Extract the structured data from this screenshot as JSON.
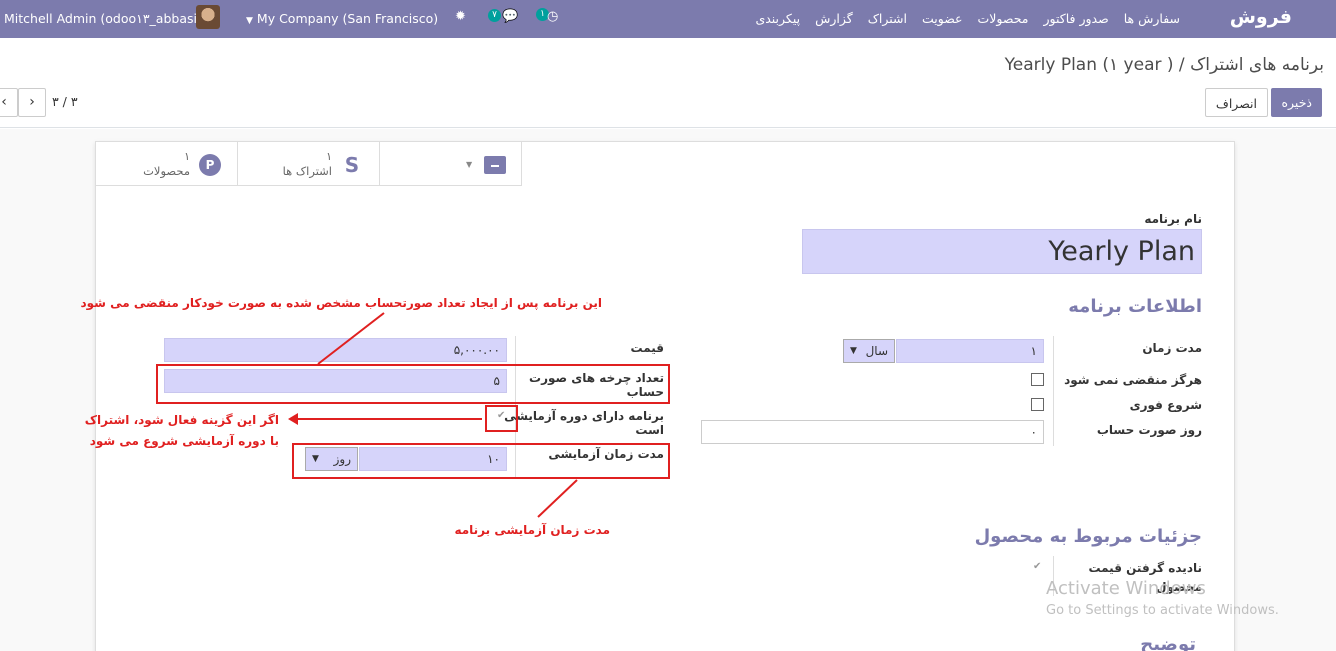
{
  "navbar": {
    "brand": "فروش",
    "menu": [
      "سفارش ها",
      "صدور فاکتور",
      "محصولات",
      "عضویت",
      "اشتراک",
      "گزارش",
      "پیکربندی"
    ],
    "user": "Mitchell Admin (odoo۱۳_abbasi)",
    "company": "My Company (San Francisco)",
    "messages_badge": "۷",
    "activity_badge": "۱"
  },
  "control_panel": {
    "breadcrumb_parent": "برنامه های اشتراک",
    "breadcrumb_separator": " / ",
    "breadcrumb_current": "Yearly Plan (۱ year )",
    "save": "ذخیره",
    "discard": "انصراف",
    "pager": "۳ / ۳"
  },
  "smart_buttons": {
    "products_count": "۱",
    "products_label": "محصولات",
    "subscriptions_count": "۱",
    "subscriptions_label": "اشتراک ها"
  },
  "form": {
    "name_label": "نام برنامه",
    "name_value": "Yearly Plan",
    "section_plan_info": "اطلاعات برنامه",
    "duration_label": "مدت زمان",
    "duration_value": "۱",
    "duration_unit": "سال",
    "never_expire_label": "هرگز منقضی نمی شود",
    "start_immediately_label": "شروع فوری",
    "invoice_day_label": "روز صورت حساب",
    "invoice_day_value": "۰",
    "price_label": "قیمت",
    "price_value": "۵,۰۰۰.۰۰",
    "billing_cycles_label_1": "تعداد چرخه های صورت",
    "billing_cycles_label_2": "حساب",
    "billing_cycles_value": "۵",
    "trial_label_1": "برنامه دارای دوره آزمایشی",
    "trial_label_2": "است",
    "trial_duration_label": "مدت زمان آزمایشی",
    "trial_duration_value": "۱۰",
    "trial_duration_unit": "روز",
    "section_product_details": "جزئیات مربوط به محصول",
    "ignore_price_label_1": "نادیده گرفتن قیمت",
    "ignore_price_label_2": "محصول",
    "section_description": "توضیح"
  },
  "annotations": {
    "expire_note": "این برنامه پس از ایجاد تعداد صورتحساب مشخص شده به صورت خودکار منقضی می شود",
    "trial_note_1": "اگر این گزینه فعال شود، اشتراک",
    "trial_note_2": "با دوره آزمایشی شروع می شود",
    "trial_duration_note": "مدت زمان آزمایشی برنامه"
  },
  "watermark": {
    "line1": "Activate Windows",
    "line2": "Go to Settings to activate Windows."
  },
  "colors": {
    "brand": "#7c7bad",
    "field_bg": "#d6d4fa",
    "annotation": "#e02020"
  }
}
